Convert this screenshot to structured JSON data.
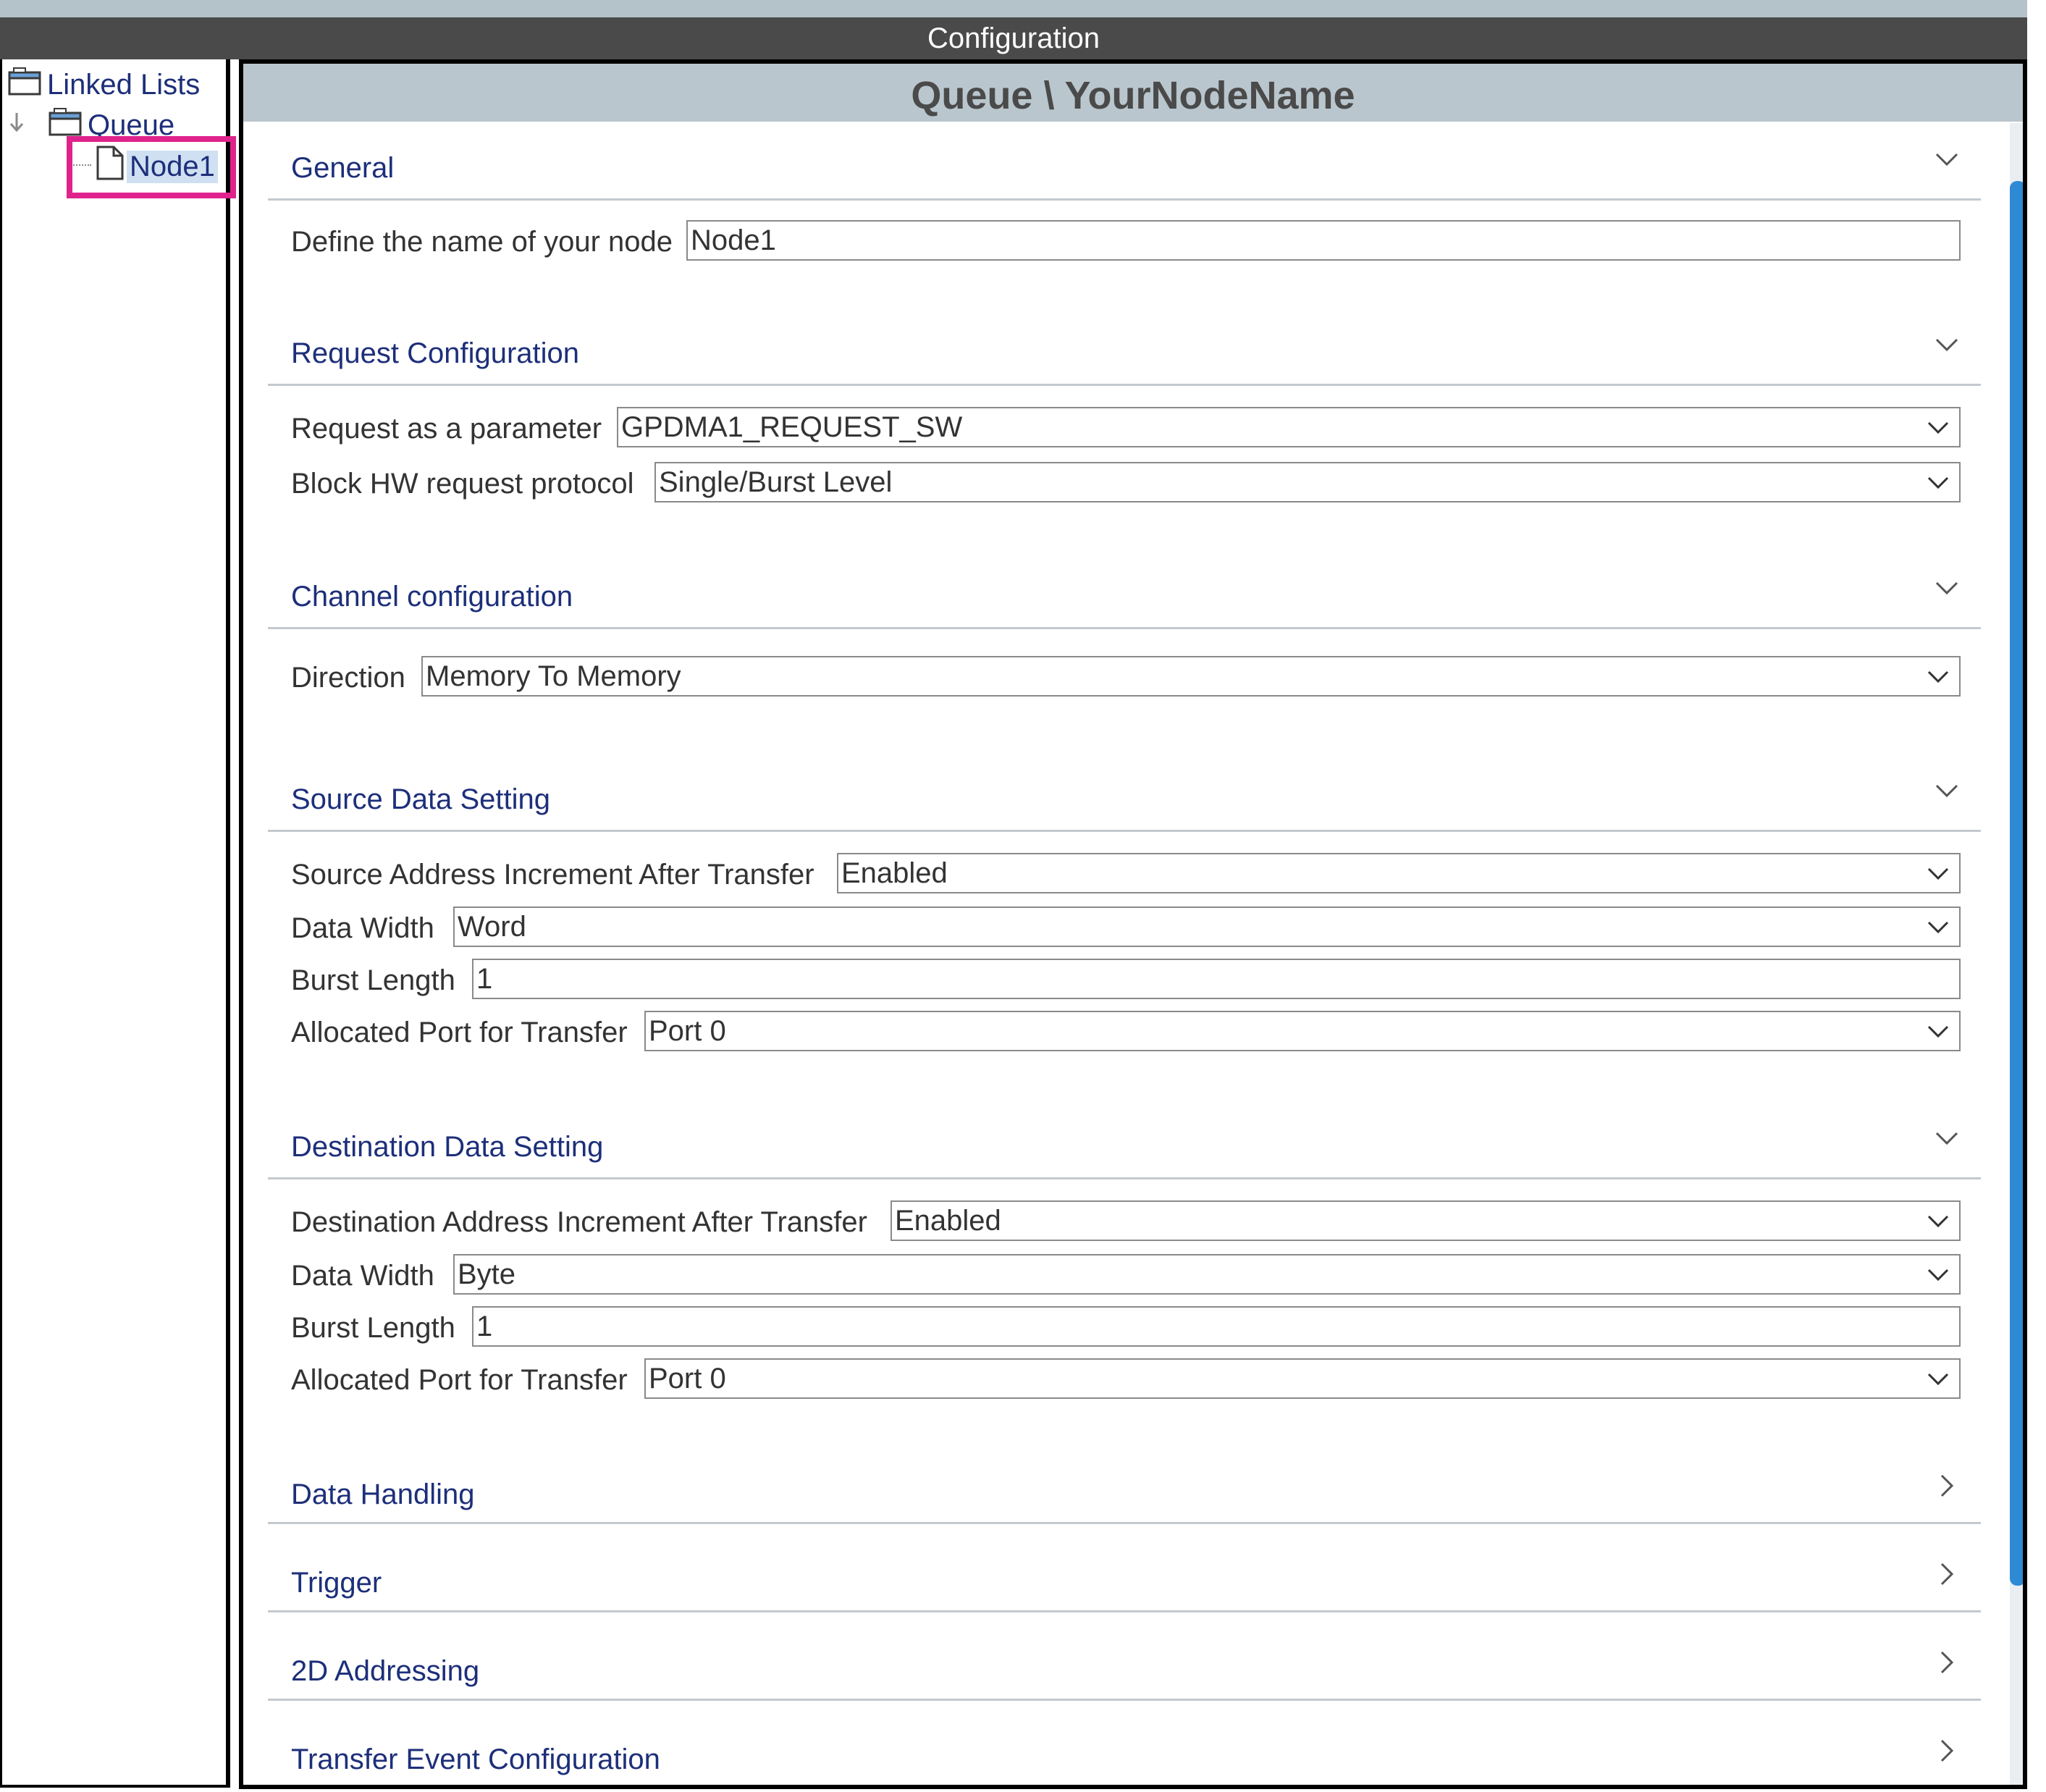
{
  "window": {
    "title": "Configuration"
  },
  "tree": {
    "root": "Linked Lists",
    "queue": "Queue",
    "node": "Node1"
  },
  "panel": {
    "header": "Queue \\ YourNodeName"
  },
  "sections": {
    "general": {
      "title": "General",
      "node_name_label": "Define the name of your node",
      "node_name_value": "Node1"
    },
    "request": {
      "title": "Request Configuration",
      "request_label": "Request as a parameter",
      "request_value": "GPDMA1_REQUEST_SW",
      "protocol_label": "Block HW request protocol",
      "protocol_value": "Single/Burst Level"
    },
    "channel": {
      "title": "Channel configuration",
      "direction_label": "Direction",
      "direction_value": "Memory To Memory"
    },
    "source": {
      "title": "Source Data Setting",
      "increment_label": "Source Address Increment After Transfer",
      "increment_value": "Enabled",
      "width_label": "Data Width",
      "width_value": "Word",
      "burst_label": "Burst Length",
      "burst_value": "1",
      "port_label": "Allocated Port for Transfer",
      "port_value": "Port 0"
    },
    "destination": {
      "title": "Destination Data Setting",
      "increment_label": "Destination Address Increment After Transfer",
      "increment_value": "Enabled",
      "width_label": "Data Width",
      "width_value": "Byte",
      "burst_label": "Burst Length",
      "burst_value": "1",
      "port_label": "Allocated Port for Transfer",
      "port_value": "Port 0"
    },
    "data_handling": {
      "title": "Data Handling"
    },
    "trigger": {
      "title": "Trigger"
    },
    "addressing_2d": {
      "title": "2D Addressing"
    },
    "transfer_event": {
      "title": "Transfer Event Configuration"
    }
  },
  "icons": {
    "expanded": "chevron-down-icon",
    "collapsed": "chevron-right-icon",
    "folder": "folder-icon",
    "document": "document-icon"
  },
  "colors": {
    "title_bar": "#4a4a4a",
    "panel_header": "#b9c6cd",
    "section_text": "#1d2f7a",
    "highlight": "#e0238c",
    "scroll_thumb": "#2f8ad6"
  }
}
